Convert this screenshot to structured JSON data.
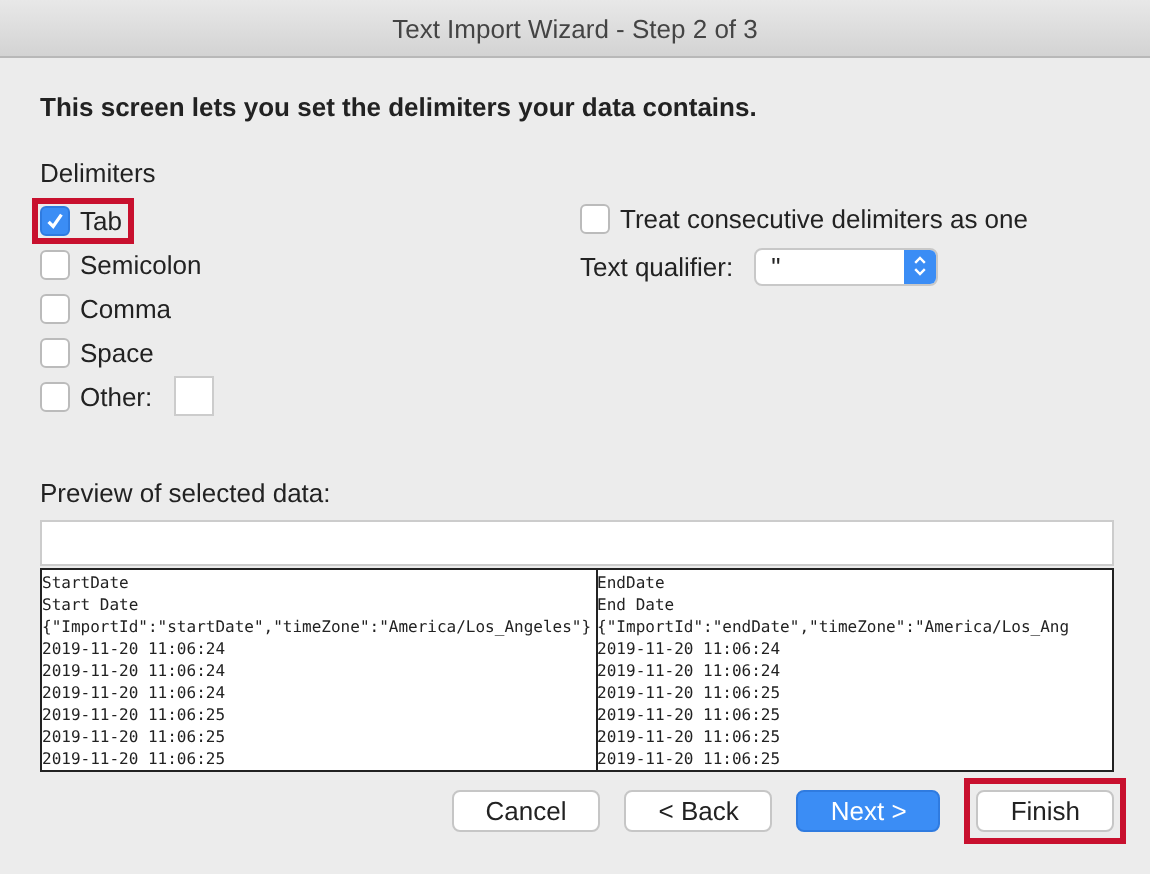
{
  "window": {
    "title": "Text Import Wizard - Step 2 of 3"
  },
  "heading": "This screen lets you set the delimiters your data contains.",
  "delimiters": {
    "label": "Delimiters",
    "items": [
      {
        "label": "Tab",
        "checked": true,
        "highlighted": true
      },
      {
        "label": "Semicolon",
        "checked": false,
        "highlighted": false
      },
      {
        "label": "Comma",
        "checked": false,
        "highlighted": false
      },
      {
        "label": "Space",
        "checked": false,
        "highlighted": false
      },
      {
        "label": "Other:",
        "checked": false,
        "highlighted": false,
        "kind": "other"
      }
    ]
  },
  "consecutive": {
    "label": "Treat consecutive delimiters as one",
    "checked": false
  },
  "text_qualifier": {
    "label": "Text qualifier:",
    "value": "\""
  },
  "preview": {
    "label": "Preview of selected data:",
    "columns": [
      [
        "StartDate",
        "Start Date",
        "{\"ImportId\":\"startDate\",\"timeZone\":\"America/Los_Angeles\"}",
        "2019-11-20 11:06:24",
        "2019-11-20 11:06:24",
        "2019-11-20 11:06:24",
        "2019-11-20 11:06:25",
        "2019-11-20 11:06:25",
        "2019-11-20 11:06:25"
      ],
      [
        "EndDate",
        "End Date",
        "{\"ImportId\":\"endDate\",\"timeZone\":\"America/Los_Ang",
        "2019-11-20 11:06:24",
        "2019-11-20 11:06:24",
        "2019-11-20 11:06:25",
        "2019-11-20 11:06:25",
        "2019-11-20 11:06:25",
        "2019-11-20 11:06:25"
      ]
    ]
  },
  "buttons": [
    {
      "label": "Cancel",
      "kind": "normal",
      "highlighted": false
    },
    {
      "label": "< Back",
      "kind": "normal",
      "highlighted": false
    },
    {
      "label": "Next >",
      "kind": "primary",
      "highlighted": false
    },
    {
      "label": "Finish",
      "kind": "normal",
      "highlighted": true
    }
  ]
}
